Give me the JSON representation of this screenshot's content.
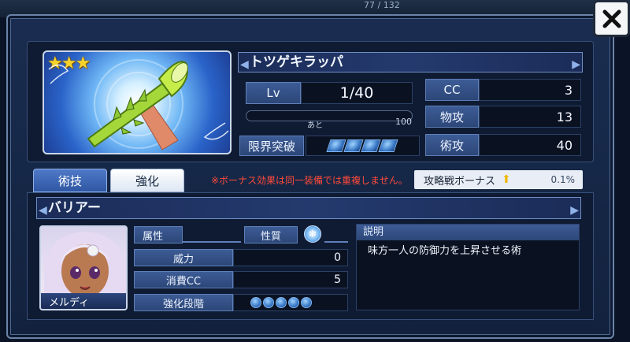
{
  "header": {
    "counter": "77 / 132"
  },
  "close_icon": "close-icon",
  "item": {
    "name": "トツゲキラッパ",
    "rarity_stars": 3,
    "stars_text": "★★★",
    "level_label": "Lv",
    "level_value": "1/40",
    "next_prefix": "あと",
    "next_value": "100",
    "limit_break_label": "限界突破",
    "limit_break_count": 4,
    "stats": [
      {
        "label": "CC",
        "value": "3"
      },
      {
        "label": "物攻",
        "value": "13"
      },
      {
        "label": "術攻",
        "value": "40"
      }
    ]
  },
  "tabs": [
    {
      "label": "術技",
      "active": true
    },
    {
      "label": "強化",
      "active": false
    }
  ],
  "bonus_note": "※ボーナス効果は同一装備では重複しません。",
  "raid_bonus": {
    "label": "攻略戦ボーナス",
    "value": "0.1%"
  },
  "skill": {
    "name": "バリアー",
    "character_name": "メルディ",
    "attribute_label": "属性",
    "nature_label": "性質",
    "rows": [
      {
        "label": "威力",
        "value": "0"
      },
      {
        "label": "消費CC",
        "value": "5"
      }
    ],
    "enhance_label": "強化段階",
    "enhance_steps": 5,
    "description_title": "説明",
    "description": "味方一人の防御力を上昇させる術"
  },
  "colors": {
    "accent_blue": "#2f57a3",
    "warning_red": "#ff4a3a",
    "star_gold": "#f7d22c"
  }
}
